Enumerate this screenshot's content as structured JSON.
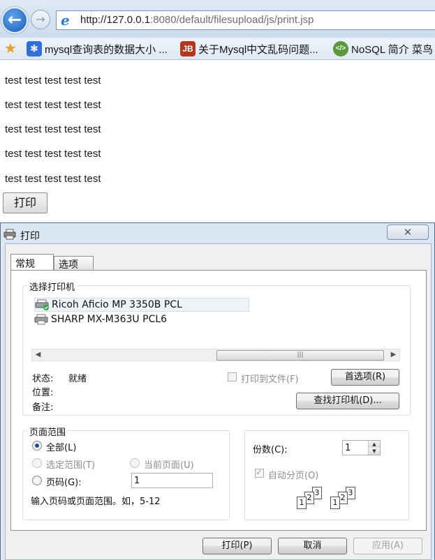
{
  "browser": {
    "url_host": "http://127.0.0.1",
    "url_path": ":8080/default/filesupload/js/print.jsp",
    "favorites": [
      {
        "label": "mysql查询表的数据大小 ..."
      },
      {
        "label": "关于Mysql中文乱码问题..."
      },
      {
        "label": "NoSQL 简介  菜鸟"
      }
    ]
  },
  "page": {
    "lines": [
      "test test test test test",
      "test test test test test",
      "test test test test test",
      "test test test test test",
      "test test test test test"
    ],
    "print_button_label": "打印"
  },
  "dialog": {
    "title": "打印",
    "close_glyph": "✕",
    "tabs": [
      {
        "label": "常规"
      },
      {
        "label": "选项"
      }
    ],
    "printer_section": {
      "label": "选择打印机",
      "printers": [
        {
          "name": "Ricoh Aficio MP 3350B PCL"
        },
        {
          "name": "SHARP MX-M363U PCL6"
        }
      ],
      "status_label": "状态:",
      "status_value": "就绪",
      "location_label": "位置:",
      "comment_label": "备注:",
      "print_to_file_label": "打印到文件(F)",
      "preferences_button": "首选项(R)",
      "find_printer_button": "查找打印机(D)..."
    },
    "page_range": {
      "label": "页面范围",
      "all_label": "全部(L)",
      "selection_label": "选定范围(T)",
      "current_page_label": "当前页面(U)",
      "pages_label": "页码(G):",
      "pages_value": "1",
      "hint": "输入页码或页面范围。如，5-12"
    },
    "copies": {
      "label": "份数(C):",
      "value": "1",
      "collate_label": "自动分页(O)"
    },
    "buttons": {
      "print": "打印(P)",
      "cancel": "取消",
      "apply": "应用(A)"
    }
  }
}
